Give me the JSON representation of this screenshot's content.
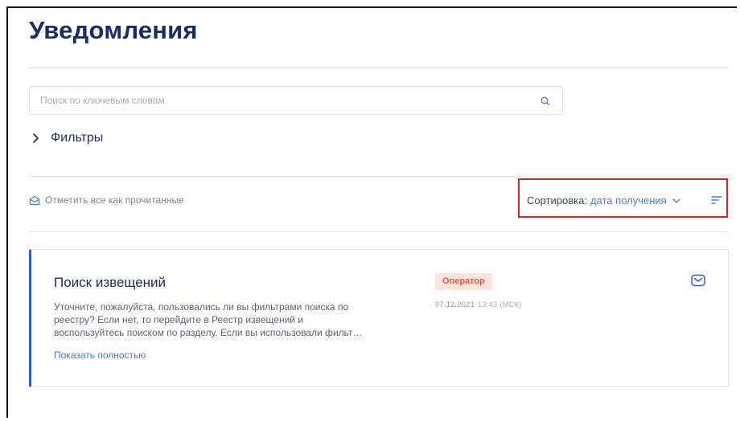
{
  "page": {
    "title": "Уведомления"
  },
  "search": {
    "placeholder": "Поиск по ключевым словам",
    "value": "",
    "icon": "search-icon"
  },
  "filters": {
    "label": "Фильтры",
    "icon": "chevron-right-icon"
  },
  "toolbar": {
    "mark_all_label": "Отметить все как прочитанные",
    "mark_all_icon": "envelope-open-icon",
    "sort_prefix": "Сортировка:",
    "sort_value": "дата получения",
    "sort_icon": "chevron-down-icon",
    "sort_order_icon": "sort-order-icon"
  },
  "notifications": [
    {
      "title": "Поиск извещений",
      "body": "Уточните, пожалуйста, пользовались ли вы фильтрами поиска по реестру? Если нет, то перейдите в Реестр извещений и воспользуйтесь поиском по разделу. Если вы использовали фильт…",
      "more_label": "Показать полностью",
      "badge": "Оператор",
      "date": "07.12.2021",
      "time": "13:43 (МСК)",
      "status_icon": "envelope-icon"
    }
  ],
  "colors": {
    "accent": "#4f78d6",
    "title": "#1b2b63",
    "card_border": "#2f5cd3",
    "badge_bg": "#fde3dc",
    "badge_text": "#e05a43",
    "highlight": "#e0202a"
  }
}
